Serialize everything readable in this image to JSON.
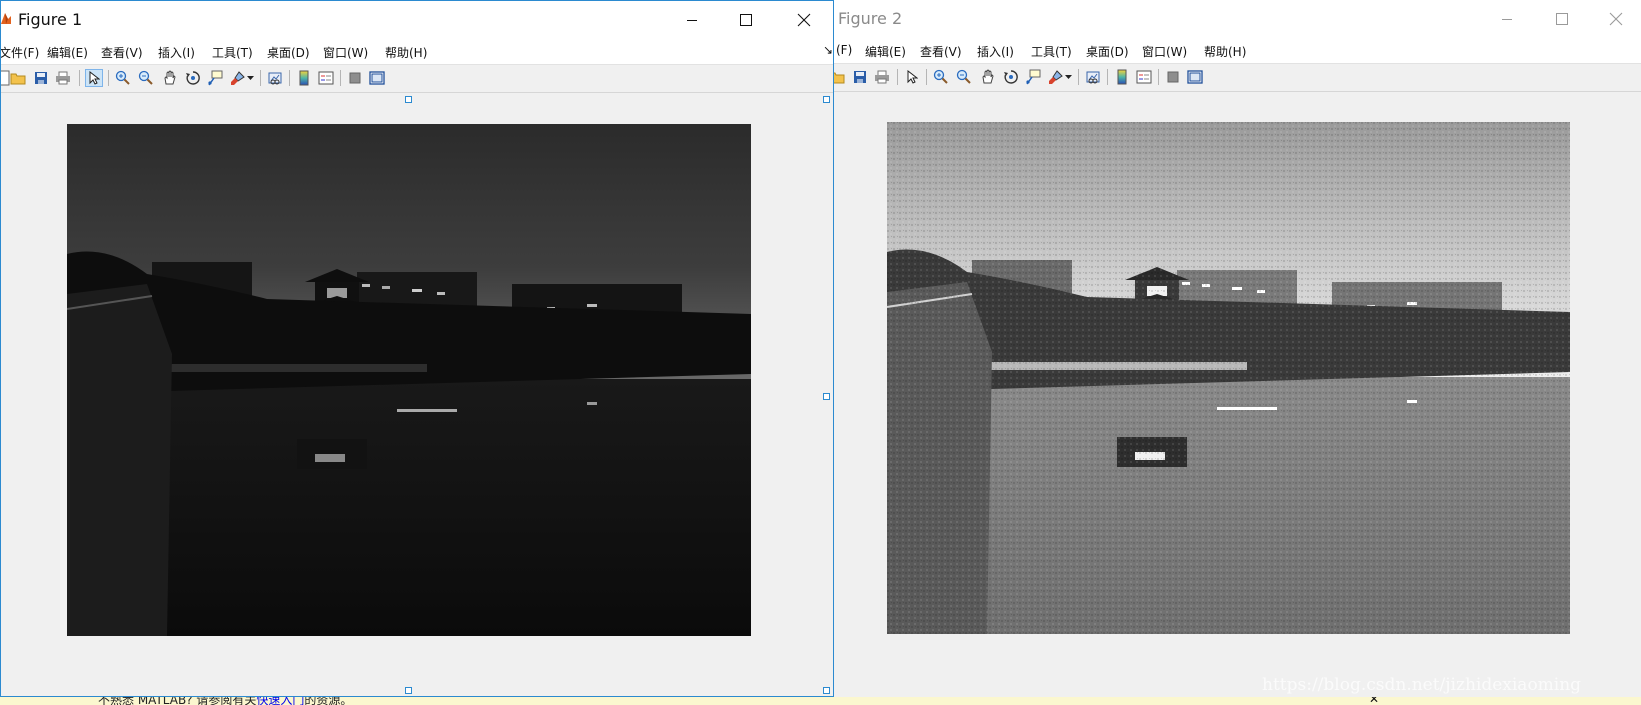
{
  "figure1": {
    "title": "Figure 1",
    "menu": [
      "文件(F)",
      "编辑(E)",
      "查看(V)",
      "插入(I)",
      "工具(T)",
      "桌面(D)",
      "窗口(W)",
      "帮助(H)"
    ],
    "image": "grayscale night photo, dark (original)"
  },
  "figure2": {
    "title": "Figure 2",
    "menu": [
      "(F)",
      "编辑(E)",
      "查看(V)",
      "插入(I)",
      "工具(T)",
      "桌面(D)",
      "窗口(W)",
      "帮助(H)"
    ],
    "image": "grayscale night photo, enhanced / brightened"
  },
  "statusbar": {
    "text_before": "不熟悉 MATLAB? 请参阅有关",
    "link": "快速入门",
    "text_after": "的资源。",
    "close": "✕"
  },
  "watermark": "https://blog.csdn.net/jizhidexiaoming",
  "colors": {
    "active_border": "#2b8ad0",
    "status_bg": "#fbf7cf",
    "window_bg": "#f0f0f0"
  },
  "icons": [
    "new-figure-icon",
    "open-folder-icon",
    "save-icon",
    "print-icon",
    "pointer-arrow-icon",
    "zoom-in-icon",
    "zoom-out-icon",
    "pan-hand-icon",
    "rotate-3d-icon",
    "data-cursor-icon",
    "brush-icon",
    "brush-dropdown-icon",
    "link-plot-icon",
    "colorbar-icon",
    "legend-icon",
    "hide-plot-tools-icon",
    "show-plot-tools-icon"
  ]
}
